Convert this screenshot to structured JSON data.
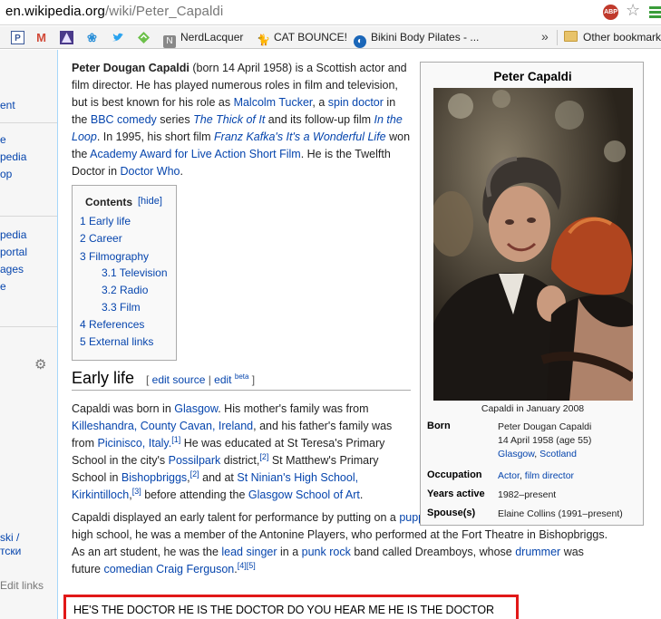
{
  "browser": {
    "url_domain": "en.wikipedia.org",
    "url_path": "/wiki/Peter_Capaldi",
    "abp_label": "ABP",
    "bookmarks": [
      {
        "icon": "pinterest-icon",
        "label": ""
      },
      {
        "icon": "gmail-icon",
        "label": ""
      },
      {
        "icon": "triangle-app-icon",
        "label": ""
      },
      {
        "icon": "hootsuite-icon",
        "label": ""
      },
      {
        "icon": "twitter-icon",
        "label": ""
      },
      {
        "icon": "feedly-icon",
        "label": ""
      },
      {
        "icon": "nerdlacquer-icon",
        "label": "NerdLacquer"
      },
      {
        "icon": "cat-icon",
        "label": "CAT BOUNCE!"
      },
      {
        "icon": "pilates-icon",
        "label": "Bikini Body Pilates - ..."
      }
    ],
    "chevron": "»",
    "other_bookmarks": "Other bookmarks",
    "colors": {
      "abp_red": "#c0392b",
      "menu_green": "#3a9d3a",
      "link_blue": "#0645ad"
    }
  },
  "sidebar": {
    "items": [
      "ent",
      "e",
      "pedia",
      "op",
      "pedia",
      "portal",
      "ages",
      "e"
    ],
    "lang_item_1": "ski /",
    "lang_item_2": "тски",
    "edit_links": "Edit links"
  },
  "article": {
    "lead": {
      "name": "Peter Dougan Capaldi",
      "t1": " (born 14 April 1958) is a Scottish actor and film director. He has played numerous roles in film and television, but is best known for his role as ",
      "l_malcolm": "Malcolm Tucker",
      "t2": ", a ",
      "l_spin": "spin doctor",
      "t3": " in the ",
      "l_bbc": "BBC comedy",
      "t4": " series ",
      "l_thick": "The Thick of It",
      "t5": " and its follow-up film ",
      "l_loop": "In the Loop",
      "t6": ". In 1995, his short film ",
      "l_kafka": "Franz Kafka's It's a Wonderful Life",
      "t7": " won the ",
      "l_academy": "Academy Award for Live Action Short Film",
      "t8": ". He is the Twelfth Doctor in ",
      "l_who": "Doctor Who",
      "t9": "."
    },
    "toc": {
      "title": "Contents",
      "hide": "[hide]",
      "items": [
        {
          "label": "1 Early life"
        },
        {
          "label": "2 Career"
        },
        {
          "label": "3 Filmography"
        },
        {
          "label": "3.1 Television"
        },
        {
          "label": "3.2 Radio"
        },
        {
          "label": "3.3 Film"
        },
        {
          "label": "4 References"
        },
        {
          "label": "5 External links"
        }
      ]
    },
    "early_life": {
      "title": "Early life",
      "br_open": "[ ",
      "edit_source": "edit source",
      "bar": " | ",
      "edit": "edit",
      "beta": "beta",
      "br_close": " ]"
    },
    "para2": {
      "t1": "Capaldi was born in ",
      "l_glasgow": "Glasgow",
      "t2": ". His mother's family was from ",
      "l_kille": "Killeshandra, County Cavan, Ireland",
      "t3": ", and his father's family was from ",
      "l_pici": "Picinisco, Italy.",
      "r1": "[1]",
      "t4": " He was educated at St Teresa's Primary School in the city's ",
      "l_poss": "Possilpark",
      "t5": " district,",
      "r2": "[2]",
      "t6": " St Matthew's Primary School in ",
      "l_bish": "Bishopbriggs",
      "t7": ",",
      "r3": "[2]",
      "t8": " and at ",
      "l_ninian": "St Ninian's High School, Kirkintilloch",
      "t9": ",",
      "r4": "[3]",
      "t10": " before attending the ",
      "l_gsa": "Glasgow School of Art",
      "t11": "."
    },
    "para3": {
      "t1": "Capaldi displayed an early talent for performance by putting on a ",
      "l_puppet": "puppet",
      "t2": " show in primary school. While at high school, he was a member of the Antonine Players, who performed at the Fort Theatre in Bishopbriggs. As an art student, he was the ",
      "l_lead": "lead singer",
      "t3": " in a ",
      "l_punk": "punk rock",
      "t4": " band called Dreamboys, whose ",
      "l_drummer": "drummer",
      "t5": " was future ",
      "l_comedian": "comedian Craig Ferguson",
      "t6": ".",
      "r5": "[4][5]"
    }
  },
  "infobox": {
    "title": "Peter Capaldi",
    "caption": "Capaldi in January 2008",
    "rows": {
      "born_label": "Born",
      "born_line1": "Peter Dougan Capaldi",
      "born_line2": "14 April 1958 (age 55)",
      "born_place_city": "Glasgow",
      "born_place_sep": ", ",
      "born_place_country": "Scotland",
      "occupation_label": "Occupation",
      "occupation_1": "Actor",
      "occupation_sep": ", ",
      "occupation_2": "film director",
      "years_label": "Years active",
      "years_value": "1982–present",
      "spouse_label": "Spouse(s)",
      "spouse_value": "Elaine Collins (1991–present)"
    }
  },
  "overlay": {
    "text": "HE'S THE DOCTOR HE IS THE DOCTOR DO YOU HEAR ME HE IS THE DOCTOR",
    "border_color": "#e11818"
  }
}
